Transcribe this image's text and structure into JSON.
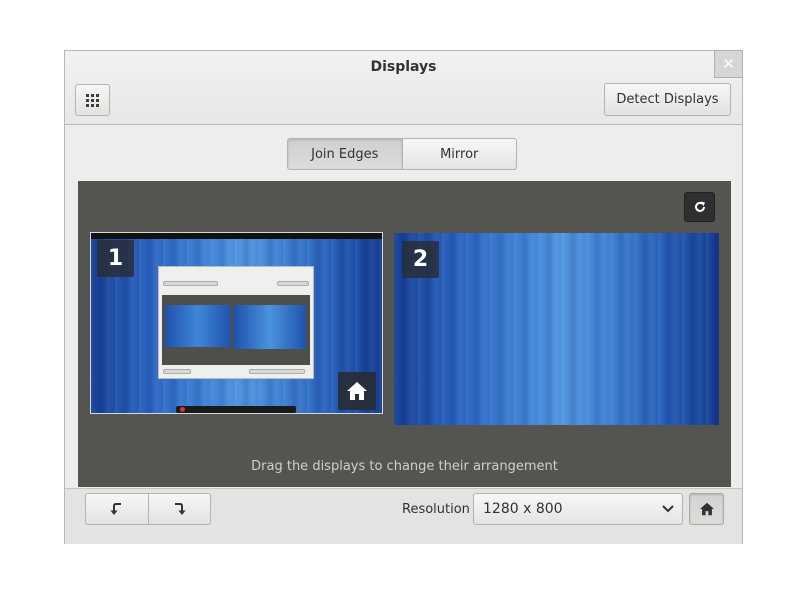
{
  "window": {
    "title": "Displays",
    "close_glyph": "✕"
  },
  "header": {
    "detect_label": "Detect Displays",
    "apps_icon": "grid-icon"
  },
  "mode": {
    "options": [
      "Join Edges",
      "Mirror"
    ],
    "selected": "Join Edges"
  },
  "stage": {
    "hint": "Drag the displays to change their arrangement",
    "rotate_icon": "refresh-icon",
    "displays": [
      {
        "number": "1",
        "primary": true
      },
      {
        "number": "2",
        "primary": false
      }
    ]
  },
  "toolbar": {
    "rotate_left_icon": "rotate-left-icon",
    "rotate_right_icon": "rotate-right-icon",
    "resolution_label": "Resolution",
    "resolution_value": "1280 x 800",
    "primary_icon": "home-icon"
  },
  "colors": {
    "stage_bg": "#545451",
    "badge_bg": "#282c34",
    "window_bg": "#ededeb"
  }
}
